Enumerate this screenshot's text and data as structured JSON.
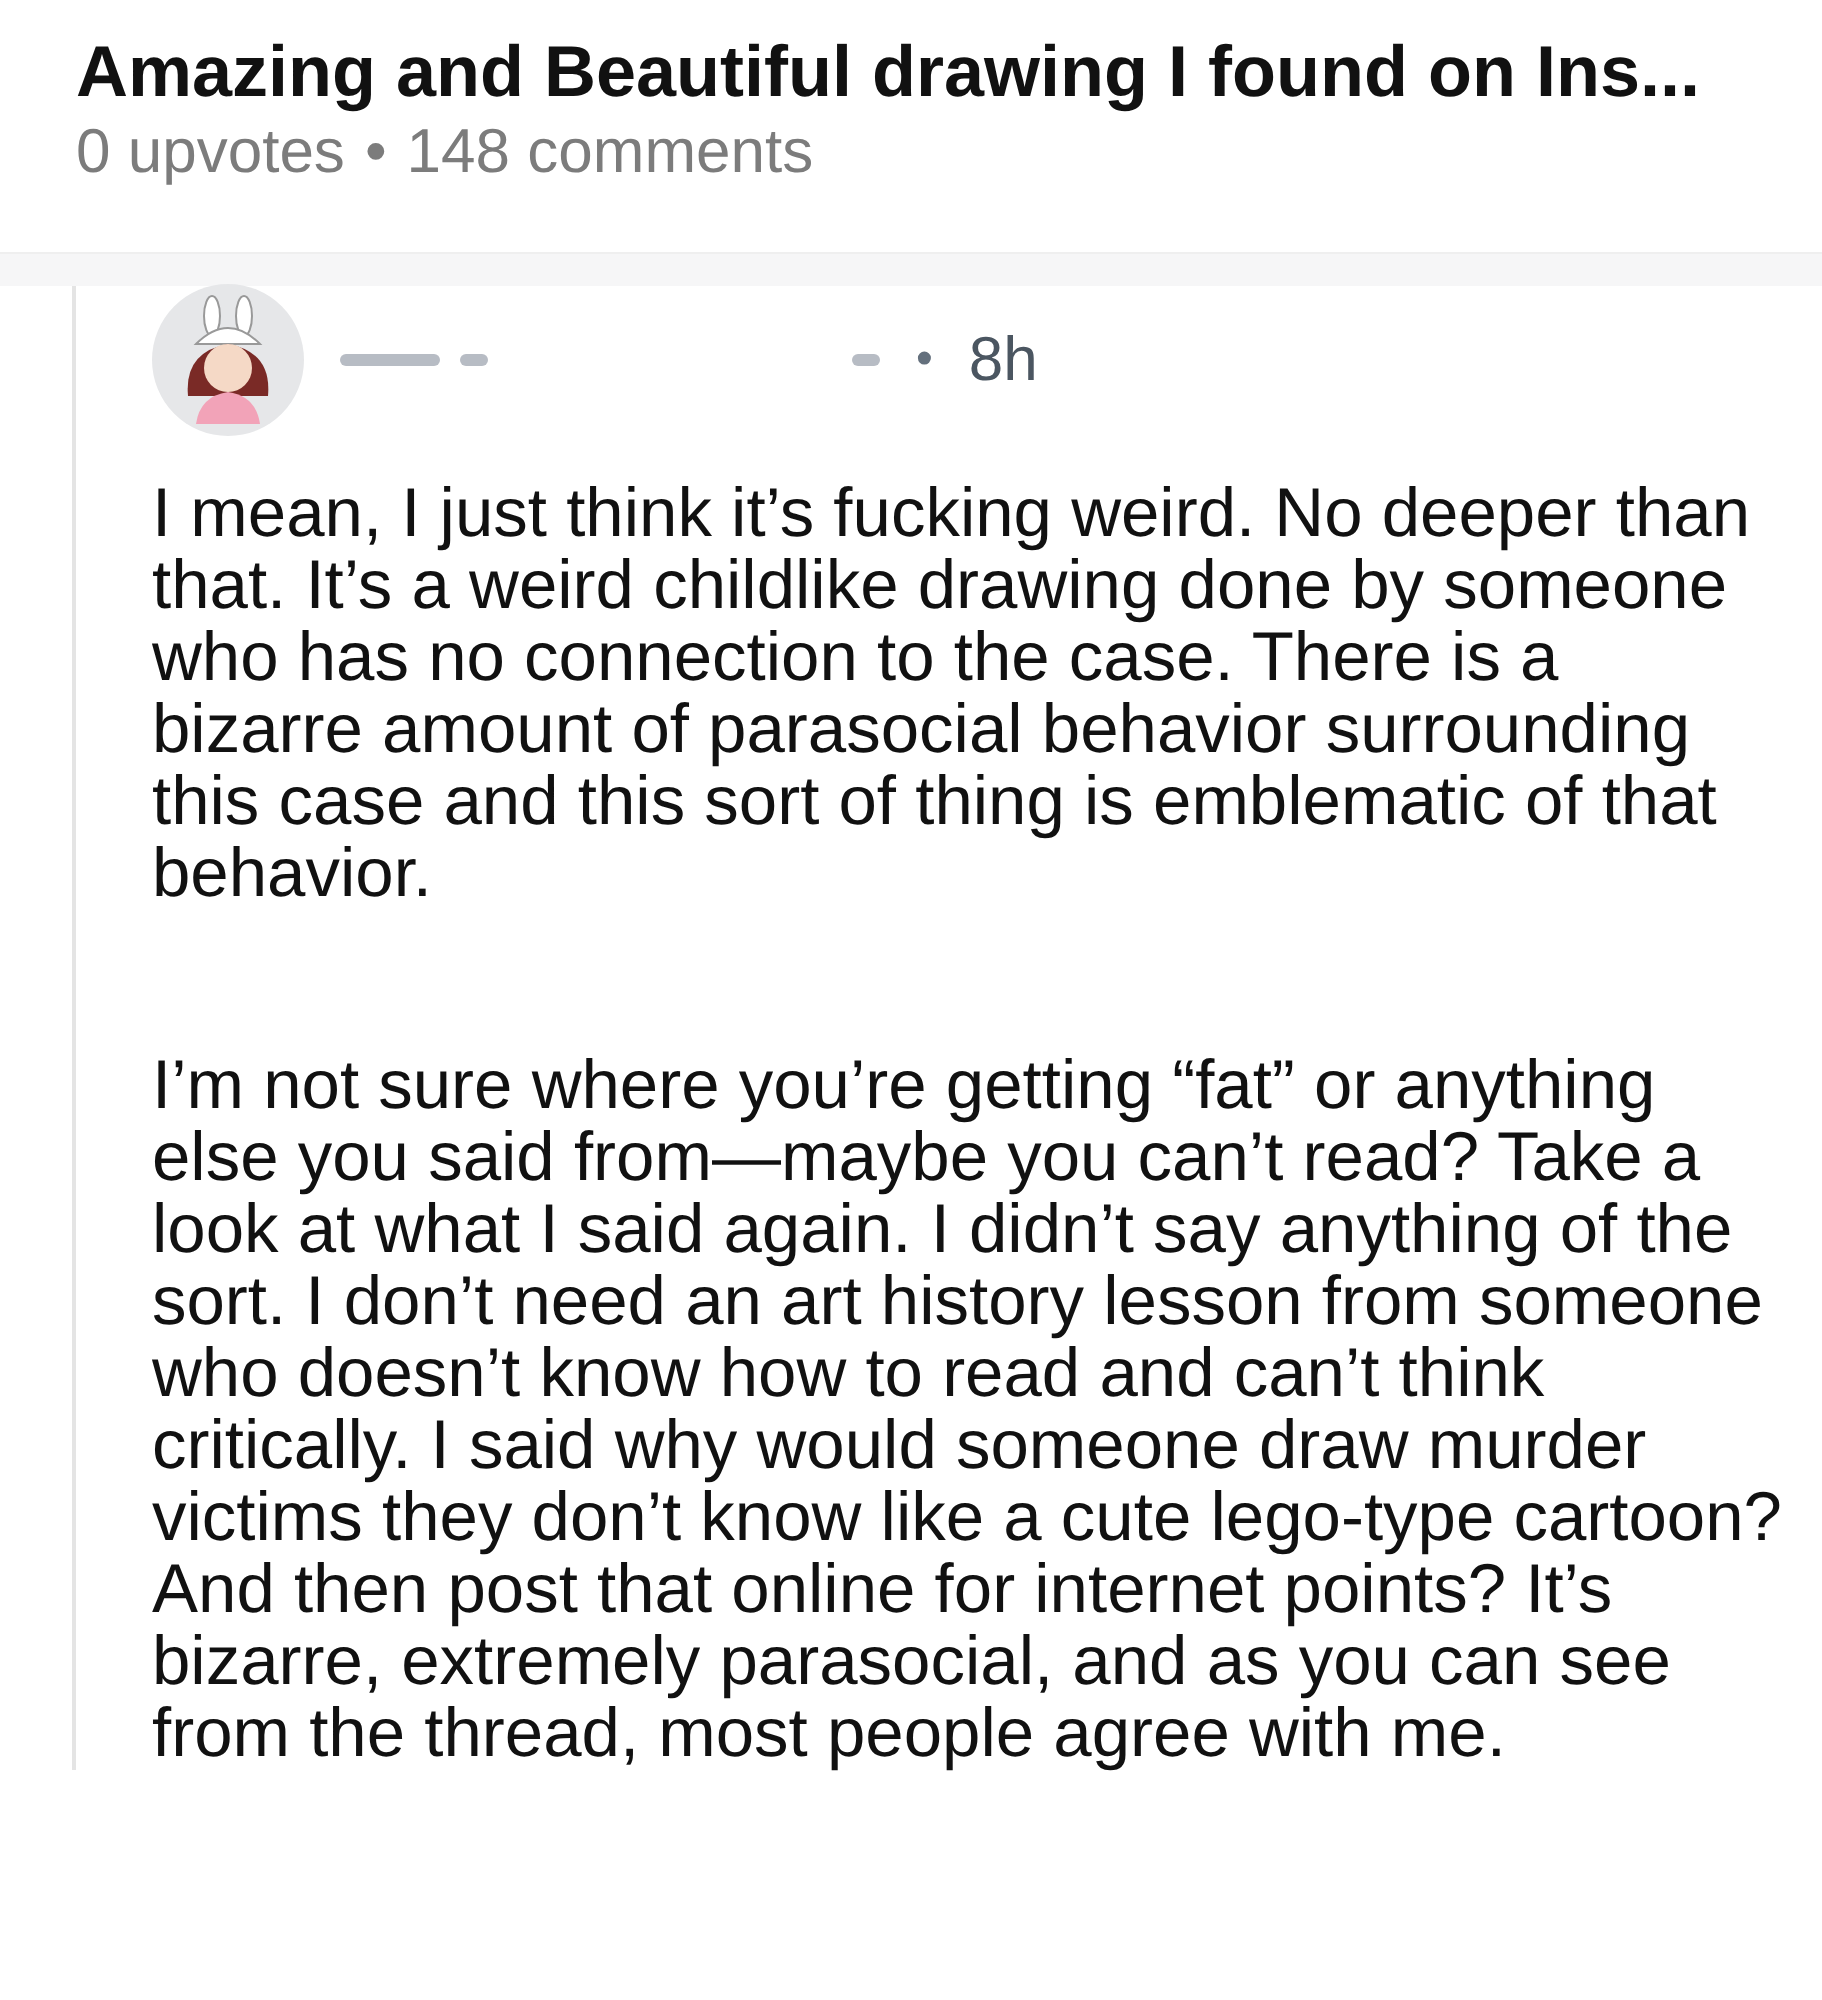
{
  "post": {
    "title": "Amazing and Beautiful drawing I found on Ins...",
    "upvotes": "0 upvotes",
    "separator": "•",
    "comments": "148 comments"
  },
  "comment": {
    "separator": "•",
    "age": "8h",
    "paragraphs": [
      "I mean, I just think it’s fucking weird. No deeper than that. It’s a weird childlike drawing done by someone who has no connection to the case. There is a bizarre amount of parasocial behavior surrounding this case and this sort of thing is emblematic of that behavior.",
      "I’m not sure where you’re getting “fat” or anything else you said from—maybe you can’t read? Take a look at what I said again. I didn’t say anything of the sort. I don’t need an art history lesson from someone who doesn’t know how to read and can’t think critically. I said why would someone draw murder victims they don’t know like a cute lego-type cartoon? And then post that online for internet points? It’s bizarre, extremely parasocial, and as you can see from the thread, most people agree with me."
    ]
  }
}
